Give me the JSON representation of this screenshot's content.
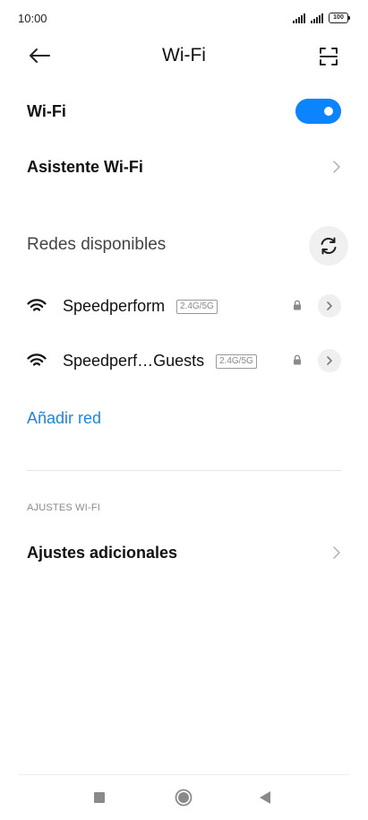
{
  "status_bar": {
    "time": "10:00",
    "battery": "100"
  },
  "header": {
    "title": "Wi-Fi"
  },
  "wifi_toggle": {
    "label": "Wi-Fi",
    "on": true
  },
  "assistant": {
    "label": "Asistente Wi-Fi"
  },
  "available": {
    "title": "Redes disponibles",
    "networks": [
      {
        "ssid": "Speedperform",
        "band": "2.4G/5G",
        "secured": true
      },
      {
        "ssid": "Speedperf…Guests",
        "band": "2.4G/5G",
        "secured": true
      }
    ]
  },
  "add_network": {
    "label": "Añadir red"
  },
  "settings": {
    "section_title": "AJUSTES WI-FI",
    "additional_label": "Ajustes adicionales"
  },
  "colors": {
    "accent": "#0d84ff",
    "link": "#1a86e0"
  },
  "icons": [
    "back-arrow-icon",
    "scan-qr-icon",
    "chevron-right-icon",
    "refresh-icon",
    "wifi-icon",
    "lock-icon",
    "recents-icon",
    "home-icon",
    "back-icon"
  ]
}
